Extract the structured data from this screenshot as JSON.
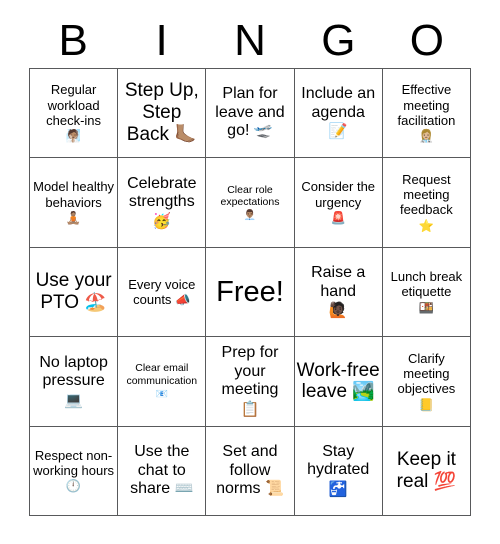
{
  "card": {
    "header_letters": [
      "B",
      "I",
      "N",
      "G",
      "O"
    ],
    "free_space_label": "Free!",
    "grid_line_color": "#58595b",
    "background_color": "#ffffff",
    "text_color": "#000000",
    "rows": 5,
    "columns": 5,
    "cells": [
      {
        "id": "b1",
        "text": "Regular workload check-ins",
        "emoji": "🧖🏽",
        "emoji_name": "person-in-steamy-room",
        "size": "sm",
        "emoji_block": true
      },
      {
        "id": "i1",
        "text": "Step Up, Step Back",
        "emoji": "🦶🏽",
        "emoji_name": "foot",
        "size": "lg",
        "emoji_block": false
      },
      {
        "id": "n1",
        "text": "Plan for leave and go!",
        "emoji": "🛫",
        "emoji_name": "airplane-departure",
        "size": "md",
        "emoji_block": false
      },
      {
        "id": "g1",
        "text": "Include an agenda",
        "emoji": "📝",
        "emoji_name": "memo",
        "size": "md",
        "emoji_block": true
      },
      {
        "id": "o1",
        "text": "Effective meeting facilitation",
        "emoji": "👩🏼‍⚕️",
        "emoji_name": "woman-health-worker",
        "size": "sm",
        "emoji_block": true
      },
      {
        "id": "b2",
        "text": "Model healthy behaviors",
        "emoji": "🧘🏽",
        "emoji_name": "person-in-lotus-position",
        "size": "sm",
        "emoji_block": true
      },
      {
        "id": "i2",
        "text": "Celebrate strengths",
        "emoji": "🥳",
        "emoji_name": "partying-face",
        "size": "md",
        "emoji_block": true
      },
      {
        "id": "n2",
        "text": "Clear role expectations",
        "emoji": "👨🏽‍💼",
        "emoji_name": "man-office-worker",
        "size": "xs",
        "emoji_block": true
      },
      {
        "id": "g2",
        "text": "Consider the urgency",
        "emoji": "🚨",
        "emoji_name": "police-car-light",
        "size": "sm",
        "emoji_block": true
      },
      {
        "id": "o2",
        "text": "Request meeting feedback",
        "emoji": "⭐",
        "emoji_name": "star",
        "size": "sm",
        "emoji_block": true
      },
      {
        "id": "b3",
        "text": "Use your PTO",
        "emoji": "🏖️",
        "emoji_name": "beach-with-umbrella",
        "size": "lg",
        "emoji_block": false
      },
      {
        "id": "i3",
        "text": "Every voice counts",
        "emoji": "📣",
        "emoji_name": "megaphone",
        "size": "sm",
        "emoji_block": false
      },
      {
        "id": "n3",
        "text": "Free!",
        "emoji": "",
        "emoji_name": "",
        "size": "xl",
        "emoji_block": false
      },
      {
        "id": "g3",
        "text": "Raise a hand",
        "emoji": "🙋🏿",
        "emoji_name": "person-raising-hand",
        "size": "md",
        "emoji_block": true
      },
      {
        "id": "o3",
        "text": "Lunch break etiquette",
        "emoji": "🍱",
        "emoji_name": "bento-box",
        "size": "sm",
        "emoji_block": true
      },
      {
        "id": "b4",
        "text": "No laptop pressure",
        "emoji": "💻",
        "emoji_name": "laptop",
        "size": "md",
        "emoji_block": true
      },
      {
        "id": "i4",
        "text": "Clear email communication",
        "emoji": "📧",
        "emoji_name": "e-mail",
        "size": "xs",
        "emoji_block": true
      },
      {
        "id": "n4",
        "text": "Prep for your meeting",
        "emoji": "📋",
        "emoji_name": "clipboard",
        "size": "md",
        "emoji_block": true
      },
      {
        "id": "g4",
        "text": "Work-free leave",
        "emoji": "🏞️",
        "emoji_name": "national-park",
        "size": "lg",
        "emoji_block": false
      },
      {
        "id": "o4",
        "text": "Clarify meeting objectives",
        "emoji": "📒",
        "emoji_name": "ledger",
        "size": "sm",
        "emoji_block": true
      },
      {
        "id": "b5",
        "text": "Respect non-working hours",
        "emoji": "🕛",
        "emoji_name": "clock-twelve-oclock",
        "size": "sm",
        "emoji_block": false
      },
      {
        "id": "i5",
        "text": "Use the chat to share",
        "emoji": "⌨️",
        "emoji_name": "keyboard",
        "size": "md",
        "emoji_block": false
      },
      {
        "id": "n5",
        "text": "Set and follow norms",
        "emoji": "📜",
        "emoji_name": "scroll",
        "size": "md",
        "emoji_block": false
      },
      {
        "id": "g5",
        "text": "Stay hydrated",
        "emoji": "🚰",
        "emoji_name": "potable-water",
        "size": "md",
        "emoji_block": true
      },
      {
        "id": "o5",
        "text": "Keep it real",
        "emoji": "💯",
        "emoji_name": "hundred-points",
        "size": "lg",
        "emoji_block": false
      }
    ]
  }
}
